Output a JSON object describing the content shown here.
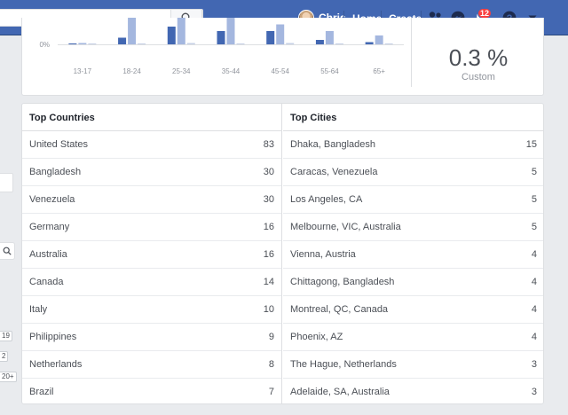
{
  "topbar": {
    "search_placeholder": "",
    "user_name": "Chris",
    "home_label": "Home",
    "create_label": "Create",
    "notification_count": "12",
    "icons": [
      "search-icon",
      "friends-icon",
      "messenger-icon",
      "notifications-icon",
      "help-icon",
      "caret-down-icon"
    ],
    "brand_color": "#4267b2"
  },
  "left_edge": {
    "counts": [
      "19",
      "2",
      "20+"
    ]
  },
  "age_chart": {
    "chart_data": {
      "type": "bar",
      "categories": [
        "13-17",
        "18-24",
        "25-34",
        "35-44",
        "45-54",
        "55-64",
        "65+"
      ],
      "series": [
        {
          "values": [
            0.2,
            1.5,
            4.0,
            3.0,
            3.0,
            1.0,
            0.5
          ],
          "color": "#4267b2"
        },
        {
          "values": [
            0.3,
            6.0,
            6.0,
            6.0,
            4.5,
            3.0,
            2.0
          ],
          "color": "#a4b7df"
        },
        {
          "values": [
            0.1,
            0.2,
            0.3,
            0.2,
            0.3,
            0.1,
            0.2
          ],
          "color": "#c7d1e6"
        }
      ],
      "ytick_labels": [
        "0%"
      ],
      "ylim": [
        0,
        8
      ]
    },
    "summary_value": "0.3 %",
    "summary_label": "Custom"
  },
  "top_countries": {
    "title": "Top Countries",
    "rows": [
      {
        "name": "United States",
        "value": "83"
      },
      {
        "name": "Bangladesh",
        "value": "30"
      },
      {
        "name": "Venezuela",
        "value": "30"
      },
      {
        "name": "Germany",
        "value": "16"
      },
      {
        "name": "Australia",
        "value": "16"
      },
      {
        "name": "Canada",
        "value": "14"
      },
      {
        "name": "Italy",
        "value": "10"
      },
      {
        "name": "Philippines",
        "value": "9"
      },
      {
        "name": "Netherlands",
        "value": "8"
      },
      {
        "name": "Brazil",
        "value": "7"
      }
    ]
  },
  "top_cities": {
    "title": "Top Cities",
    "rows": [
      {
        "name": "Dhaka, Bangladesh",
        "value": "15"
      },
      {
        "name": "Caracas, Venezuela",
        "value": "5"
      },
      {
        "name": "Los Angeles, CA",
        "value": "5"
      },
      {
        "name": "Melbourne, VIC, Australia",
        "value": "5"
      },
      {
        "name": "Vienna, Austria",
        "value": "4"
      },
      {
        "name": "Chittagong, Bangladesh",
        "value": "4"
      },
      {
        "name": "Montreal, QC, Canada",
        "value": "4"
      },
      {
        "name": "Phoenix, AZ",
        "value": "4"
      },
      {
        "name": "The Hague, Netherlands",
        "value": "3"
      },
      {
        "name": "Adelaide, SA, Australia",
        "value": "3"
      }
    ]
  }
}
